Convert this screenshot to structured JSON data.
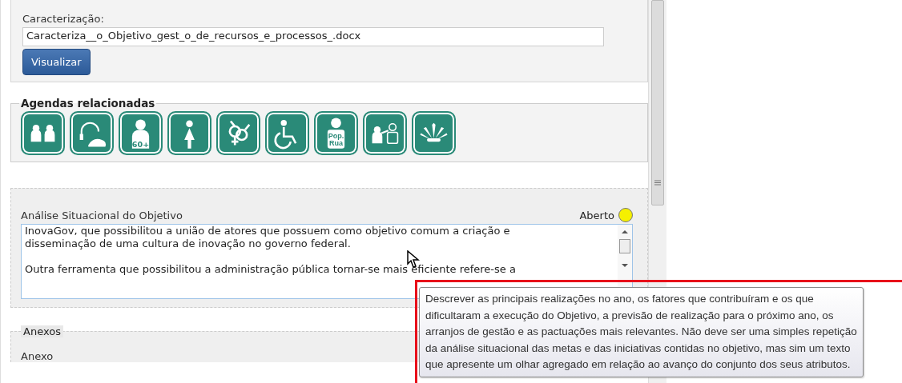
{
  "caracterizacao": {
    "label": "Caracterização:",
    "value": "Caracteriza__o_Objetivo_gest_o_de_recursos_e_processos_.docx",
    "button": "Visualizar"
  },
  "agendas": {
    "title": "Agendas relacionadas",
    "icons": [
      {
        "kind": "children"
      },
      {
        "kind": "headset"
      },
      {
        "kind": "elderly",
        "text": "60+"
      },
      {
        "kind": "woman"
      },
      {
        "kind": "gender"
      },
      {
        "kind": "wheelchair"
      },
      {
        "kind": "homeless",
        "text": "Pop.\nRua"
      },
      {
        "kind": "teacher"
      },
      {
        "kind": "headdress"
      }
    ]
  },
  "analise": {
    "label": "Análise Situacional do Objetivo",
    "status": {
      "label": "Aberto",
      "color": "#f5f000"
    },
    "paragraphs": [
      "InovaGov, que possibilitou a união de atores que possuem como objetivo comum a criação e\ndisseminação de uma cultura de inovação no governo federal.",
      "Outra ferramenta que possibilitou a administração pública tornar-se mais eficiente refere-se a"
    ]
  },
  "anexos": {
    "title": "Anexos",
    "label": "Anexo"
  },
  "tooltip": {
    "text": "Descrever as principais realizações no ano, os fatores que contribuíram e os que\ndificultaram a execução do Objetivo, a previsão de realização para o próximo ano, os\narranjos de gestão e as pactuações mais relevantes. Não deve ser uma simples repetição\nda análise situacional das metas e das iniciativas contidas no objetivo, mas sim um texto\nque apresente um olhar agregado em relação ao avanço do conjunto dos seus atributos."
  }
}
